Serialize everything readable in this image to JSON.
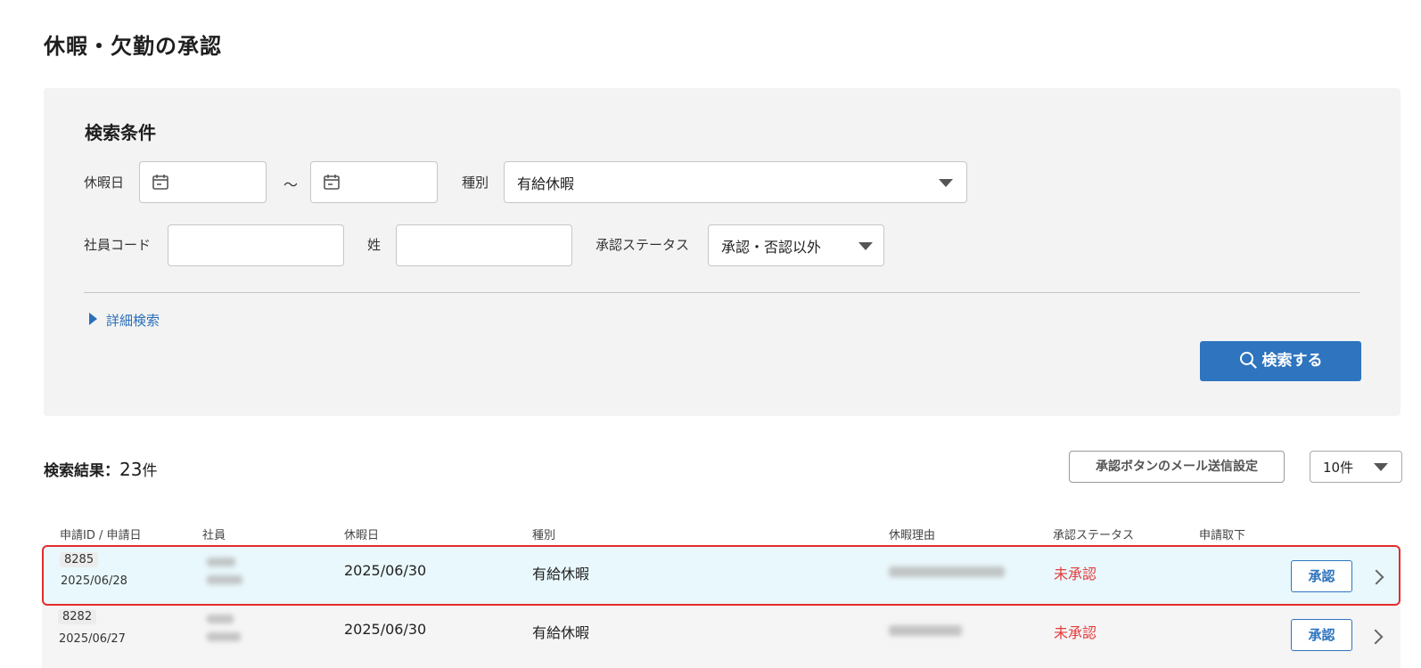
{
  "page_title": "休暇・欠勤の承認",
  "search": {
    "title": "検索条件",
    "vacation_date_label": "休暇日",
    "date_from_value": "",
    "date_to_value": "",
    "range_separator": "〜",
    "type_label": "種別",
    "type_value": "有給休暇",
    "employee_code_label": "社員コード",
    "employee_code_value": "",
    "last_name_label": "姓",
    "last_name_value": "",
    "status_label": "承認ステータス",
    "status_value": "承認・否認以外",
    "advanced_label": "詳細検索",
    "search_button_label": "検索する"
  },
  "results": {
    "label": "検索結果",
    "colon": "：",
    "count": "23",
    "unit": "件",
    "mail_button_label": "承認ボタンのメール送信設定",
    "per_page_value": "10件"
  },
  "table": {
    "headers": [
      "申請ID / 申請日",
      "社員",
      "休暇日",
      "種別",
      "休暇理由",
      "承認ステータス",
      "申請取下"
    ],
    "rows": [
      {
        "id": "8285",
        "request_date": "2025/06/28",
        "vacation_date": "2025/06/30",
        "type": "有給休暇",
        "status": "未承認",
        "action": "承認"
      },
      {
        "id": "8282",
        "request_date": "2025/06/27",
        "vacation_date": "2025/06/30",
        "type": "有給休暇",
        "status": "未承認",
        "action": "承認"
      }
    ]
  },
  "colors": {
    "primary": "#2e74be",
    "status_unapproved": "#e53b3b",
    "selected_row_bg": "#e9f8fc",
    "highlight_border": "#e52b2b"
  }
}
